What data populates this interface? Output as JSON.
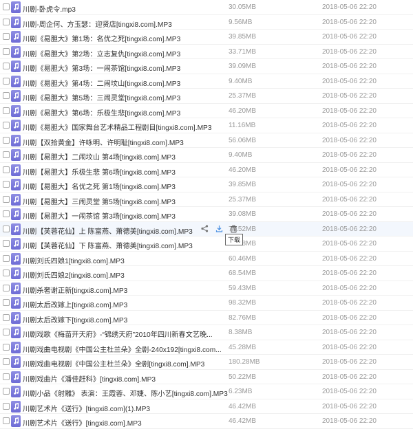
{
  "files": [
    {
      "name": "川剧-卧虎令.mp3",
      "size": "30.05MB",
      "date": "2018-05-06 22:20"
    },
    {
      "name": "川剧-周企何、方玉瑟：迎贤店[tingxi8.com].MP3",
      "size": "9.56MB",
      "date": "2018-05-06 22:20"
    },
    {
      "name": "川剧《易胆大》第1场：名优之死[tingxi8.com].MP3",
      "size": "39.85MB",
      "date": "2018-05-06 22:20"
    },
    {
      "name": "川剧《易胆大》第2场：立志复仇[tingxi8.com].MP3",
      "size": "33.71MB",
      "date": "2018-05-06 22:20"
    },
    {
      "name": "川剧《易胆大》第3场：一闹茶馆[tingxi8.com].MP3",
      "size": "39.09MB",
      "date": "2018-05-06 22:20"
    },
    {
      "name": "川剧《易胆大》第4场：二闹坟山[tingxi8.com].MP3",
      "size": "9.40MB",
      "date": "2018-05-06 22:20"
    },
    {
      "name": "川剧《易胆大》第5场：三闹灵堂[tingxi8.com].MP3",
      "size": "25.37MB",
      "date": "2018-05-06 22:20"
    },
    {
      "name": "川剧《易胆大》第6场：乐极生悲[tingxi8.com].MP3",
      "size": "46.20MB",
      "date": "2018-05-06 22:20"
    },
    {
      "name": "川剧《易胆大》国家舞台艺术精品工程剧目[tingxi8.com].MP3",
      "size": "11.16MB",
      "date": "2018-05-06 22:20"
    },
    {
      "name": "川剧【双拾黄金】许咏明、许明耻[tingxi8.com].MP3",
      "size": "56.06MB",
      "date": "2018-05-06 22:20"
    },
    {
      "name": "川剧【易胆大】二闹坟山 第4场[tingxi8.com].MP3",
      "size": "9.40MB",
      "date": "2018-05-06 22:20"
    },
    {
      "name": "川剧【易胆大】乐极生悲 第6场[tingxi8.com].MP3",
      "size": "46.20MB",
      "date": "2018-05-06 22:20"
    },
    {
      "name": "川剧【易胆大】名优之死 第1场[tingxi8.com].MP3",
      "size": "39.85MB",
      "date": "2018-05-06 22:20"
    },
    {
      "name": "川剧【易胆大】三闹灵堂 第5场[tingxi8.com].MP3",
      "size": "25.37MB",
      "date": "2018-05-06 22:20"
    },
    {
      "name": "川剧【易胆大】一闹茶馆 第3场[tingxi8.com].MP3",
      "size": "39.08MB",
      "date": "2018-05-06 22:20"
    },
    {
      "name": "川剧【芙蓉花仙】上 陈富燕、萧德美[tingxi8.com].MP3",
      "size": "74.52MB",
      "date": "2018-05-06 22:20"
    },
    {
      "name": "川剧【芙蓉花仙】下 陈富燕、萧德美[tingxi8.com].MP3",
      "size": "75.68MB",
      "date": "2018-05-06 22:20"
    },
    {
      "name": "川剧刘氏四娘1[tingxi8.com].MP3",
      "size": "60.46MB",
      "date": "2018-05-06 22:20"
    },
    {
      "name": "川剧刘氏四娘2[tingxi8.com].MP3",
      "size": "68.54MB",
      "date": "2018-05-06 22:20"
    },
    {
      "name": "川剧杀奢谢正新[tingxi8.com].MP3",
      "size": "59.43MB",
      "date": "2018-05-06 22:20"
    },
    {
      "name": "川剧太后改嫁上[tingxi8.com].MP3",
      "size": "98.32MB",
      "date": "2018-05-06 22:20"
    },
    {
      "name": "川剧太后改嫁下[tingxi8.com].MP3",
      "size": "82.76MB",
      "date": "2018-05-06 22:20"
    },
    {
      "name": "川剧戏歌《梅苗开天府》-“锦绣天府”2010年四川新春文艺晚...",
      "size": "8.38MB",
      "date": "2018-05-06 22:20"
    },
    {
      "name": "川剧戏曲电视剧《中国公主杜兰朵》全剧-240x192[tingxi8.com...",
      "size": "45.28MB",
      "date": "2018-05-06 22:20"
    },
    {
      "name": "川剧戏曲电视剧《中国公主杜兰朵》全剧[tingxi8.com].MP3",
      "size": "180.28MB",
      "date": "2018-05-06 22:20"
    },
    {
      "name": "川剧戏曲片《潘佳赶科》[tingxi8.com].MP3",
      "size": "50.22MB",
      "date": "2018-05-06 22:20"
    },
    {
      "name": "川剧小品《射雕》 表演：王霞蓉、邓婕、陈小艺[tingxi8.com].MP3",
      "size": "6.23MB",
      "date": "2018-05-06 22:20"
    },
    {
      "name": "川剧艺术片《送行》[tingxi8.com](1).MP3",
      "size": "46.42MB",
      "date": "2018-05-06 22:20"
    },
    {
      "name": "川剧艺术片《送行》[tingxi8.com].MP3",
      "size": "46.42MB",
      "date": "2018-05-06 22:20"
    }
  ],
  "hover_row_index": 15,
  "row_actions": {
    "share_icon": "share-icon",
    "download_icon": "download-icon",
    "delete_icon": "trash-icon"
  },
  "tooltip": {
    "text": "下载"
  },
  "colors": {
    "file_icon": "#7b79dd",
    "action_icon": "#7a7a7a",
    "download_icon": "#4a90e2",
    "muted_text": "#999999"
  }
}
